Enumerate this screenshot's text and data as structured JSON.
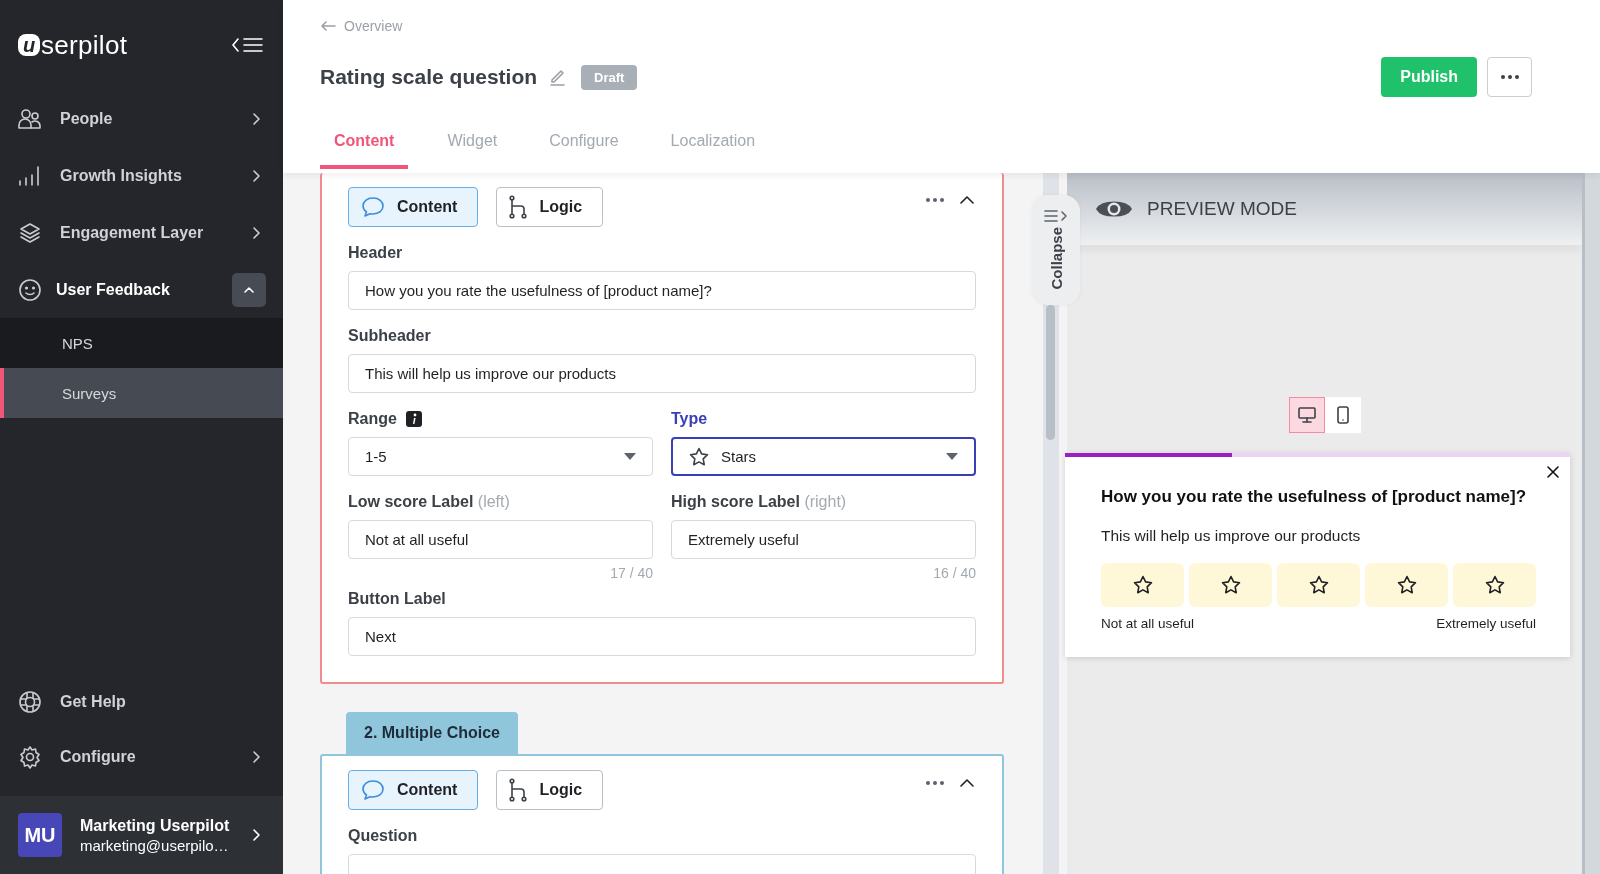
{
  "sidebar": {
    "logo_mark": "u",
    "logo_text": "serpilot",
    "items": [
      {
        "label": "People",
        "expanded": false
      },
      {
        "label": "Growth Insights",
        "expanded": false
      },
      {
        "label": "Engagement Layer",
        "expanded": false
      },
      {
        "label": "User Feedback",
        "expanded": true,
        "children": [
          {
            "label": "NPS",
            "selected": false
          },
          {
            "label": "Surveys",
            "selected": true
          }
        ]
      }
    ],
    "footer_items": [
      {
        "label": "Get Help",
        "kind": "link"
      },
      {
        "label": "Configure",
        "kind": "menu"
      }
    ],
    "account": {
      "initials": "MU",
      "name": "Marketing Userpilot",
      "email": "marketing@userpilo…"
    }
  },
  "header": {
    "back_link": "Overview",
    "title": "Rating scale question",
    "status": "Draft",
    "publish": "Publish",
    "tabs": [
      {
        "label": "Content",
        "selected": true
      },
      {
        "label": "Widget",
        "selected": false
      },
      {
        "label": "Configure",
        "selected": false
      },
      {
        "label": "Localization",
        "selected": false
      }
    ]
  },
  "questions": [
    {
      "selected": true,
      "modes": [
        {
          "label": "Content",
          "selected": true
        },
        {
          "label": "Logic",
          "selected": false
        }
      ],
      "rows": [
        [
          {
            "kind": "text",
            "label": "Header",
            "value": "How you you rate the usefulness of [product name]?",
            "focused": false
          }
        ],
        [
          {
            "kind": "text",
            "label": "Subheader",
            "value": "This will help us improve our products",
            "focused": false
          }
        ],
        [
          {
            "kind": "select",
            "label": "Range",
            "info": true,
            "value": "1-5",
            "focused": false
          },
          {
            "kind": "star-select",
            "label": "Type",
            "value": "Stars",
            "focused": true
          }
        ],
        [
          {
            "kind": "text",
            "label": "Low score Label",
            "hint": "(left)",
            "value": "Not at all useful",
            "counter": "17 / 40",
            "focused": false
          },
          {
            "kind": "text",
            "label": "High score Label",
            "hint": "(right)",
            "value": "Extremely useful",
            "counter": "16 / 40",
            "focused": false
          }
        ],
        [
          {
            "kind": "text",
            "label": "Button Label",
            "value": "Next",
            "focused": false
          }
        ]
      ]
    },
    {
      "selected": false,
      "title": "2. Multiple Choice",
      "modes": [
        {
          "label": "Content",
          "selected": true
        },
        {
          "label": "Logic",
          "selected": false
        }
      ],
      "rows": [
        [
          {
            "kind": "text",
            "label": "Question",
            "focused": false
          }
        ]
      ]
    }
  ],
  "preview": {
    "collapse": "Collapse",
    "title": "PREVIEW MODE",
    "devices": [
      {
        "kind": "desktop",
        "selected": true
      },
      {
        "kind": "mobile",
        "selected": false
      }
    ],
    "widget": {
      "progress": {
        "level": 0.33
      },
      "question": "How you you rate the usefulness of [product name]?",
      "subtitle": "This will help us improve our products",
      "options": [
        {
          "selected": false
        },
        {
          "selected": false
        },
        {
          "selected": false
        },
        {
          "selected": false
        },
        {
          "selected": false
        }
      ],
      "low_label": "Not at all useful",
      "high_label": "Extremely useful"
    }
  }
}
